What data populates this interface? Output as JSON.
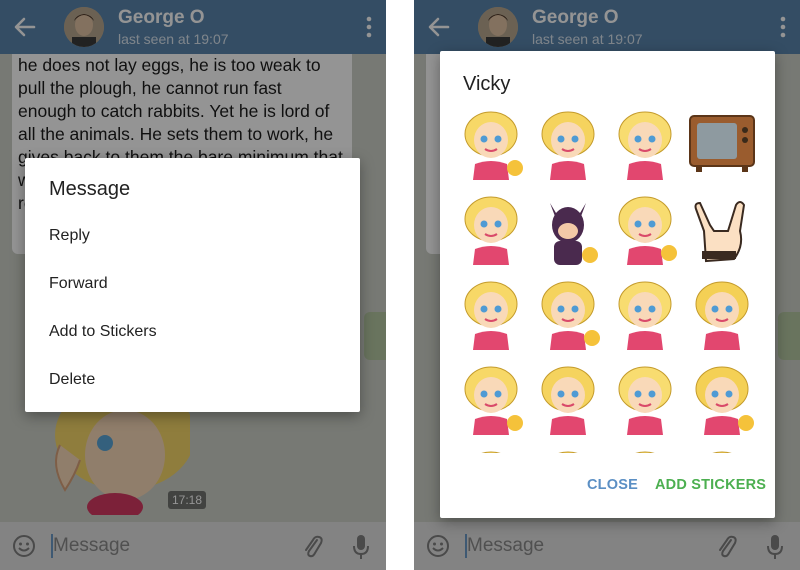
{
  "left": {
    "header": {
      "name": "George O",
      "status": "last seen at 19:07"
    },
    "chat": {
      "message_text": "he does not lay eggs, he is too weak to pull the plough, he cannot run fast enough to catch rabbits. Yet he is lord of all the animals. He sets them to work, he gives back to them the bare minimum that will prevent them from starving, and the rest",
      "time": "17:18"
    },
    "input": {
      "placeholder": "Message"
    },
    "dialog": {
      "title": "Message",
      "items": [
        {
          "label": "Reply"
        },
        {
          "label": "Forward"
        },
        {
          "label": "Add to Stickers"
        },
        {
          "label": "Delete"
        }
      ]
    }
  },
  "right": {
    "header": {
      "name": "George O",
      "status": "last seen at 19:07"
    },
    "input": {
      "placeholder": "Message"
    },
    "sticker_dialog": {
      "title": "Vicky",
      "close_label": "CLOSE",
      "add_label": "ADD STICKERS",
      "stickers": [
        "girl-in-glass-sticker",
        "girl-kiss-sticker",
        "girl-wink-sticker",
        "tv-sticker",
        "girl-laugh-sticker",
        "catwoman-sticker",
        "girl-tongue-sticker",
        "rock-hand-sticker",
        "girl-crying-sticker",
        "girl-thumbsup-sticker",
        "bride-sticker",
        "girl-scared-sticker",
        "girl-rocket-sticker",
        "girl-sunglasses-sticker",
        "girl-moon-sticker",
        "girl-bath-sticker",
        "baby-sticker",
        "girl-crown-sticker",
        "girl-peek-sticker",
        "girl-blonde-sticker"
      ]
    }
  },
  "colors": {
    "header": "#5a86ad",
    "accent_blue": "#5b8fc4",
    "accent_green": "#4caf50"
  }
}
